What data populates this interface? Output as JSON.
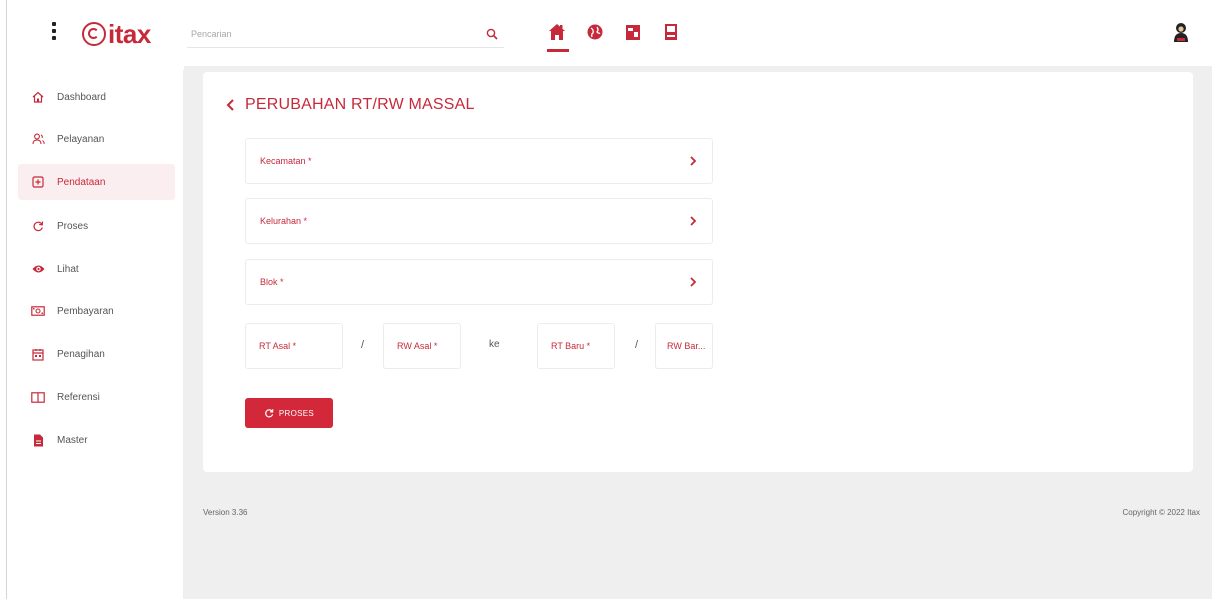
{
  "app": {
    "logo_text": "itax",
    "brand_color": "#c62a3a"
  },
  "header": {
    "search_placeholder": "Pencarian",
    "icons": [
      "home-icon",
      "globe-icon",
      "document-icon",
      "book-icon"
    ],
    "active_icon": "home-icon",
    "user_icon": "user-icon"
  },
  "sidebar": {
    "items": [
      {
        "label": "Dashboard",
        "icon": "home-outline-icon",
        "active": false
      },
      {
        "label": "Pelayanan",
        "icon": "users-icon",
        "active": false
      },
      {
        "label": "Pendataan",
        "icon": "plus-box-icon",
        "active": true
      },
      {
        "label": "Proses",
        "icon": "refresh-icon",
        "active": false
      },
      {
        "label": "Lihat",
        "icon": "eye-icon",
        "active": false
      },
      {
        "label": "Pembayaran",
        "icon": "money-icon",
        "active": false
      },
      {
        "label": "Penagihan",
        "icon": "calendar-icon",
        "active": false
      },
      {
        "label": "Referensi",
        "icon": "open-book-icon",
        "active": false
      },
      {
        "label": "Master",
        "icon": "file-icon",
        "active": false
      }
    ]
  },
  "main": {
    "title": "PERUBAHAN RT/RW MASSAL",
    "fields": {
      "kecamatan": "Kecamatan *",
      "kelurahan": "Kelurahan *",
      "blok": "Blok *",
      "rt_asal": "RT Asal *",
      "rw_asal": "RW Asal *",
      "rt_baru": "RT Baru *",
      "rw_baru": "RW Bar..."
    },
    "separator_slash": "/",
    "separator_ke": "ke",
    "proses_button": "PROSES"
  },
  "footer": {
    "version": "Version 3.36",
    "copyright": "Copyright © 2022 Itax"
  }
}
